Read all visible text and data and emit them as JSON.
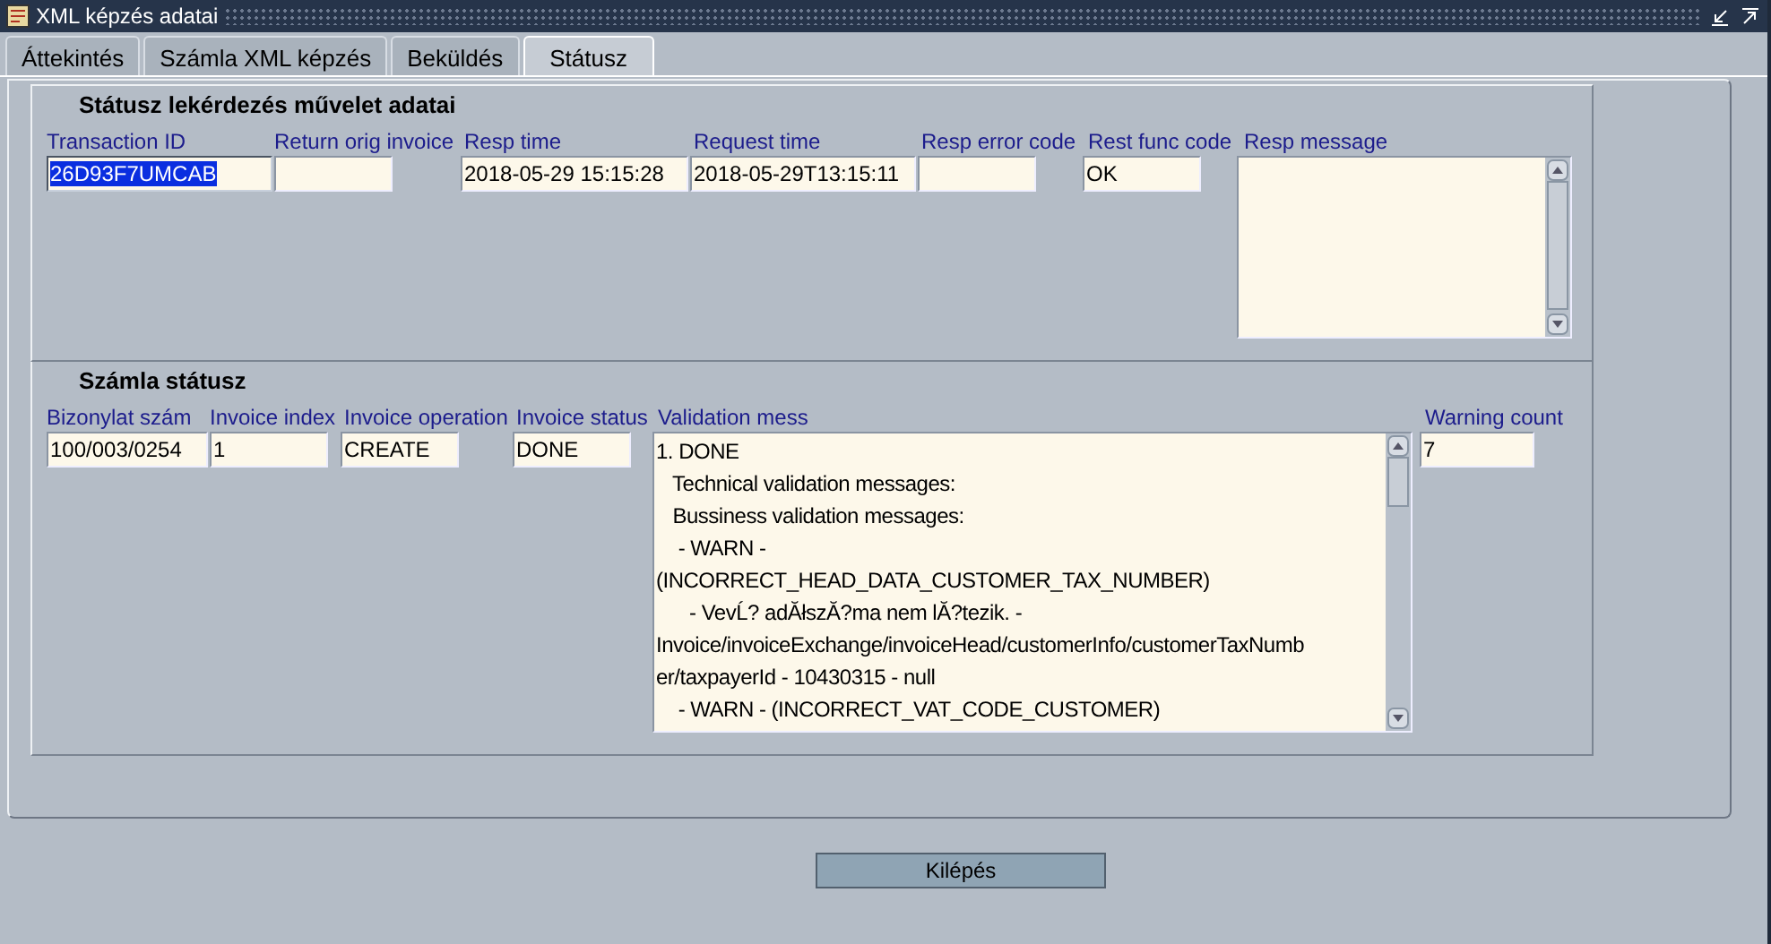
{
  "window": {
    "title": "XML képzés adatai"
  },
  "tabs": [
    {
      "label": "Áttekintés",
      "selected": false
    },
    {
      "label": "Számla XML képzés",
      "selected": false
    },
    {
      "label": "Beküldés",
      "selected": false
    },
    {
      "label": "Státusz",
      "selected": true
    }
  ],
  "sections": [
    {
      "title": "Státusz lekérdezés művelet adatai",
      "fields": [
        {
          "label": "Transaction ID",
          "value": "26D93F7UMCAB",
          "highlighted": true
        },
        {
          "label": "Return orig invoice",
          "highlighted": false
        },
        {
          "label": "Resp time",
          "value": "2018-05-29 15:15:28",
          "highlighted": false
        },
        {
          "label": "Request time",
          "value": "2018-05-29T13:15:11",
          "highlighted": false
        },
        {
          "label": "Resp error code",
          "highlighted": false
        },
        {
          "label": "Rest func code",
          "value": "OK",
          "highlighted": false
        },
        {
          "label": "Resp message",
          "kind": "multiline",
          "highlighted": false
        }
      ]
    },
    {
      "title": "Számla státusz",
      "fields": [
        {
          "label": "Bizonylat szám",
          "value": "100/003/0254",
          "highlighted": false
        },
        {
          "label": "Invoice index",
          "value": "1",
          "highlighted": false
        },
        {
          "label": "Invoice operation",
          "value": "CREATE",
          "highlighted": false
        },
        {
          "label": "Invoice status",
          "value": "DONE",
          "highlighted": false
        },
        {
          "label": "Validation mess",
          "kind": "multiline",
          "highlighted": false,
          "lines": [
            "1. DONE",
            "   Technical validation messages:",
            "   Bussiness validation messages:",
            "    - WARN -",
            "(INCORRECT_HEAD_DATA_CUSTOMER_TAX_NUMBER)",
            "      - VevĹ? adĂłszĂ?ma nem lĂ?tezik. -",
            "Invoice/invoiceExchange/invoiceHead/customerInfo/customerTaxNumb",
            "er/taxpayerId - 10430315 - null",
            "    - WARN - (INCORRECT_VAT_CODE_CUSTOMER)"
          ]
        },
        {
          "label": "Warning count",
          "value": "7",
          "highlighted": false
        }
      ]
    }
  ],
  "buttons": [
    {
      "label": "Kilépés"
    }
  ]
}
